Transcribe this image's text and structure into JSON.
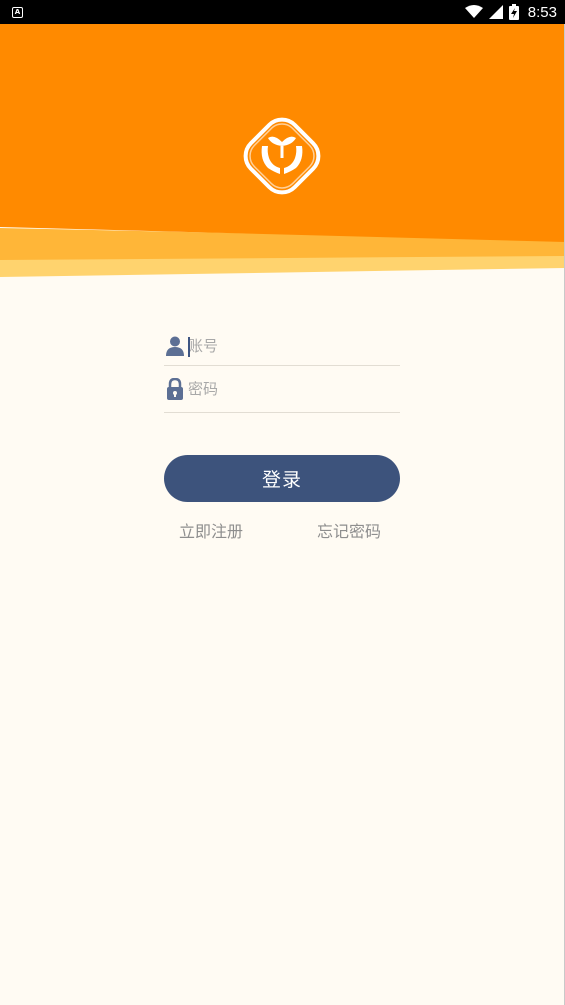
{
  "status_bar": {
    "notification_icon": "A",
    "time": "8:53",
    "icons": [
      "wifi-icon",
      "cell-signal-icon",
      "battery-charging-icon"
    ]
  },
  "colors": {
    "header_orange": "#FF8A00",
    "wave_light": "#FFB638",
    "wave_pale": "#FFD36E",
    "background": "#FFFBF3",
    "button": "#3D537C",
    "icon_blue": "#5C6F94",
    "link_gray": "#8E8E8E"
  },
  "form": {
    "account_placeholder": "账号",
    "password_placeholder": "密码"
  },
  "buttons": {
    "login_label": "登录"
  },
  "links": {
    "register": "立即注册",
    "forgot_password": "忘记密码"
  }
}
